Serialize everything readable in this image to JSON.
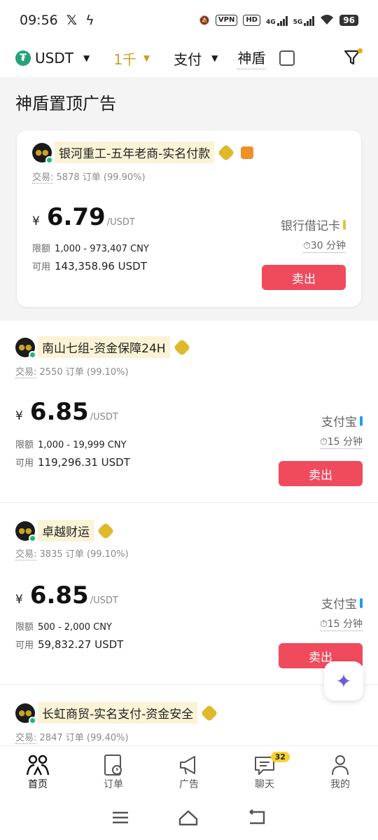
{
  "status_bar": {
    "time": "09:56",
    "vpn": "VPN",
    "hd": "HD",
    "net1": "4G",
    "net2": "5G",
    "battery": "96"
  },
  "filter_bar": {
    "currency": "USDT",
    "amount": "1千",
    "payment": "支付",
    "shield_label": "神盾"
  },
  "pinned": {
    "title": "神盾置顶广告",
    "card": {
      "merchant": "银河重工-五年老商-实名付款",
      "trade_label": "交易:",
      "trade_stats": "5878 订单 (99.90%)",
      "yen": "¥",
      "price": "6.79",
      "unit": "/USDT",
      "limit_label": "限额",
      "limit_value": "1,000 - 973,407 CNY",
      "avail_label": "可用",
      "avail_value": "143,358.96 USDT",
      "pay_method": "银行借记卡",
      "pay_color": "#e7c33b",
      "time": "30 分钟",
      "sell": "卖出"
    }
  },
  "ads": [
    {
      "merchant": "南山七组-资金保障24H",
      "trade_label": "交易:",
      "trade_stats": "2550 订单 (99.10%)",
      "yen": "¥",
      "price": "6.85",
      "unit": "/USDT",
      "limit_label": "限额",
      "limit_value": "1,000 - 19,999 CNY",
      "avail_label": "可用",
      "avail_value": "119,296.31 USDT",
      "pay_method": "支付宝",
      "pay_color": "#1aa0e6",
      "time": "15 分钟",
      "sell": "卖出"
    },
    {
      "merchant": "卓越财运",
      "trade_label": "交易:",
      "trade_stats": "3835 订单 (99.10%)",
      "yen": "¥",
      "price": "6.85",
      "unit": "/USDT",
      "limit_label": "限额",
      "limit_value": "500 - 2,000 CNY",
      "avail_label": "可用",
      "avail_value": "59,832.27 USDT",
      "pay_method": "支付宝",
      "pay_color": "#1aa0e6",
      "time": "15 分钟",
      "sell": "卖出"
    },
    {
      "merchant": "长虹商贸-实名支付-资金安全",
      "trade_label": "交易:",
      "trade_stats": "2847 订单 (99.40%)"
    }
  ],
  "bottom_nav": [
    {
      "label": "首页"
    },
    {
      "label": "订单"
    },
    {
      "label": "广告"
    },
    {
      "label": "聊天",
      "badge": "32"
    },
    {
      "label": "我的"
    }
  ],
  "colors": {
    "sell": "#ef4b5d",
    "online": "#1fb873",
    "accent": "#c9a227"
  }
}
